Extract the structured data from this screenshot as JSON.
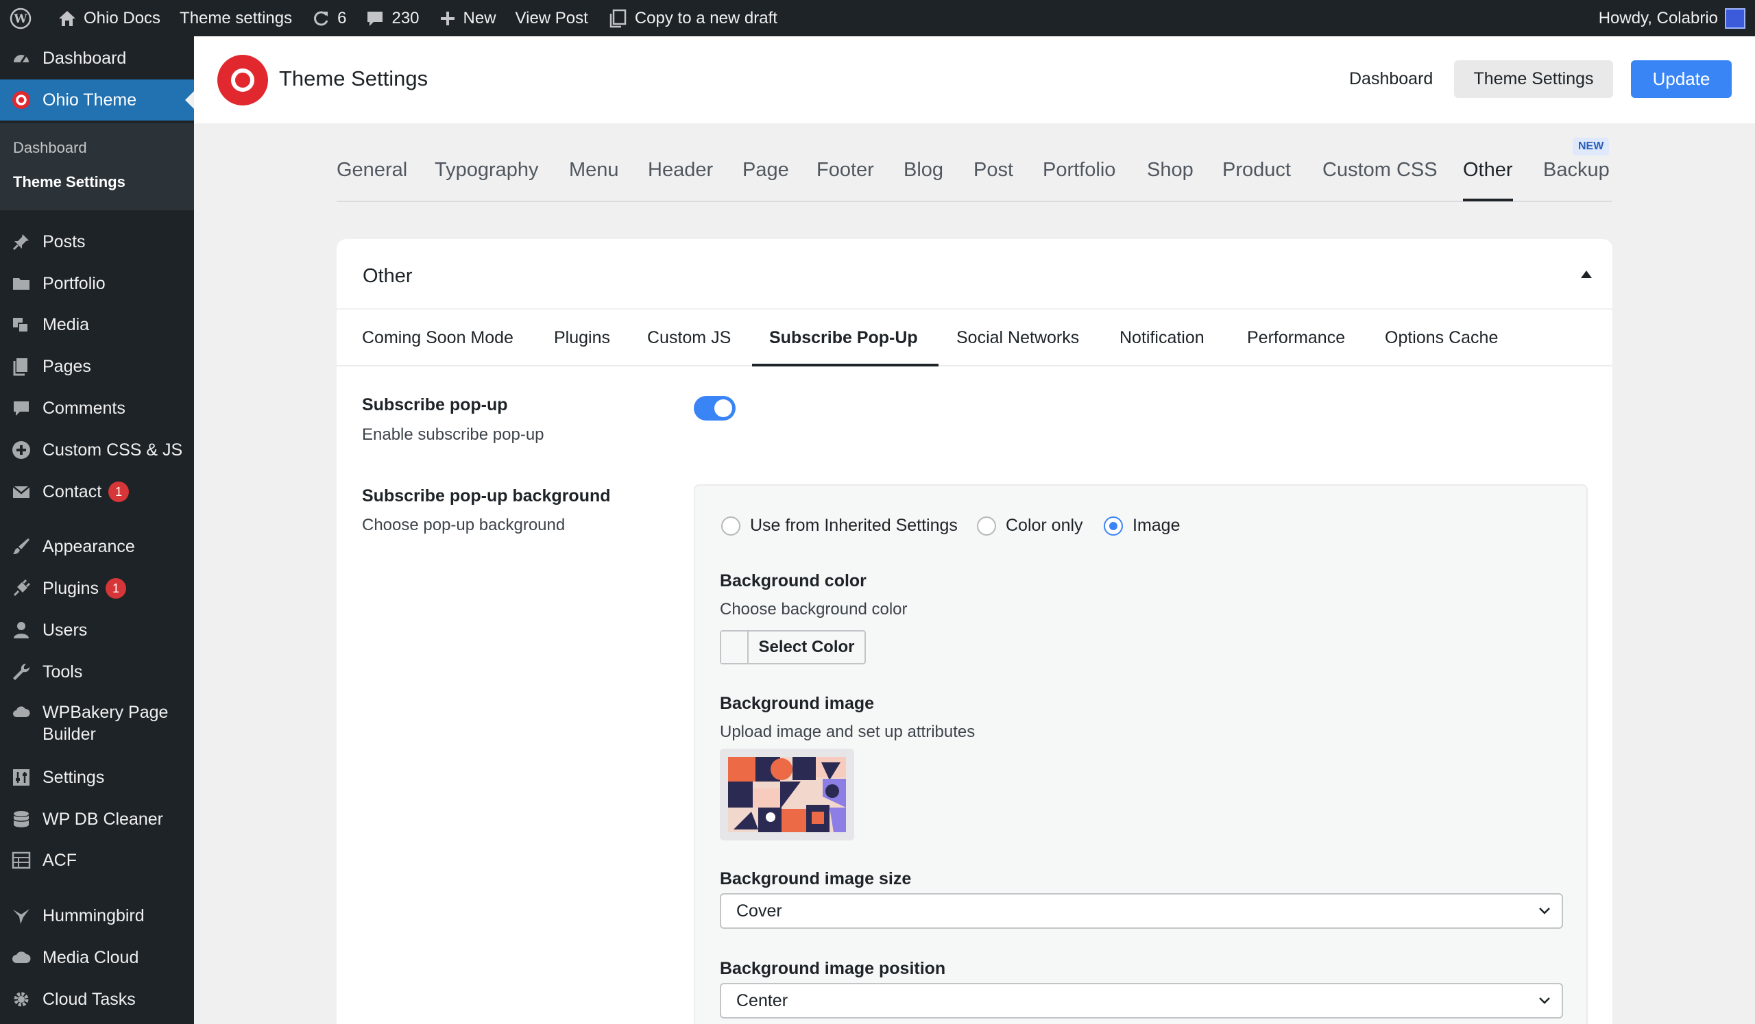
{
  "adminbar": {
    "site_name": "Ohio Docs",
    "theme_settings": "Theme settings",
    "updates_count": "6",
    "comments_count": "230",
    "new_label": "New",
    "view_post": "View Post",
    "copy_draft": "Copy to a new draft",
    "howdy": "Howdy, Colabrio"
  },
  "sidebar": {
    "dashboard": "Dashboard",
    "ohio_theme": "Ohio Theme",
    "sub_dashboard": "Dashboard",
    "sub_theme_settings": "Theme Settings",
    "posts": "Posts",
    "portfolio": "Portfolio",
    "media": "Media",
    "pages": "Pages",
    "comments": "Comments",
    "custom_css_js": "Custom CSS & JS",
    "contact": "Contact",
    "contact_badge": "1",
    "appearance": "Appearance",
    "plugins": "Plugins",
    "plugins_badge": "1",
    "users": "Users",
    "tools": "Tools",
    "wpbakery_line1": "WPBakery Page",
    "wpbakery_line2": "Builder",
    "settings": "Settings",
    "wp_db_cleaner": "WP DB Cleaner",
    "acf": "ACF",
    "hummingbird": "Hummingbird",
    "media_cloud": "Media Cloud",
    "cloud_tasks": "Cloud Tasks"
  },
  "header": {
    "title": "Theme Settings",
    "dashboard_link": "Dashboard",
    "theme_settings_btn": "Theme Settings",
    "update_btn": "Update"
  },
  "tabs": {
    "general": "General",
    "typography": "Typography",
    "menu": "Menu",
    "header": "Header",
    "page": "Page",
    "footer": "Footer",
    "blog": "Blog",
    "post": "Post",
    "portfolio": "Portfolio",
    "shop": "Shop",
    "product": "Product",
    "custom_css": "Custom CSS",
    "other": "Other",
    "backup": "Backup",
    "new_badge": "NEW"
  },
  "panel": {
    "title": "Other",
    "subtabs": {
      "coming_soon": "Coming Soon Mode",
      "plugins": "Plugins",
      "custom_js": "Custom JS",
      "subscribe": "Subscribe Pop-Up",
      "social": "Social Networks",
      "notification": "Notification",
      "performance": "Performance",
      "options_cache": "Options Cache"
    },
    "subscribe_popup": {
      "title": "Subscribe pop-up",
      "desc": "Enable subscribe pop-up"
    },
    "background": {
      "title": "Subscribe pop-up background",
      "desc": "Choose pop-up background",
      "radio_inherited": "Use from Inherited Settings",
      "radio_color": "Color only",
      "radio_image": "Image",
      "bg_color_title": "Background color",
      "bg_color_desc": "Choose background color",
      "select_color": "Select Color",
      "bg_image_title": "Background image",
      "bg_image_desc": "Upload image and set up attributes",
      "bg_size_title": "Background image size",
      "bg_size_value": "Cover",
      "bg_position_title": "Background image position",
      "bg_position_value": "Center"
    }
  }
}
